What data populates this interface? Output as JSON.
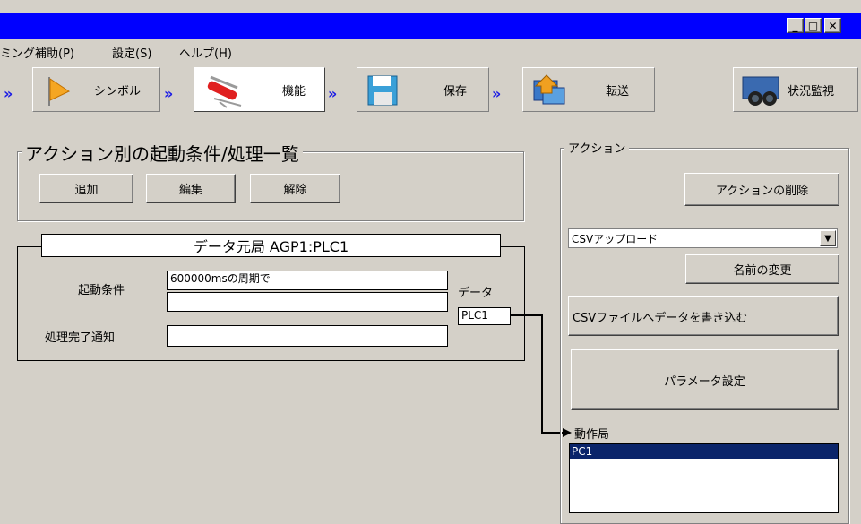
{
  "menu": {
    "items": [
      "ミング補助(P)",
      "設定(S)",
      "ヘルプ(H)"
    ]
  },
  "window_controls": {
    "minimize": "_",
    "maximize": "□",
    "close": "✕"
  },
  "toolbar": {
    "symbol_label": "シンボル",
    "function_label": "機能",
    "save_label": "保存",
    "transfer_label": "転送",
    "monitor_label": "状況監視",
    "arrow": "»"
  },
  "action_list": {
    "title": "アクション別の起動条件/処理一覧",
    "add_label": "追加",
    "edit_label": "編集",
    "delete_label": "解除"
  },
  "data_source": {
    "title": "データ元局 AGP1:PLC1",
    "trigger_label": "起動条件",
    "trigger_value": "600000msの周期で",
    "trigger_value2": "",
    "notify_label": "処理完了通知",
    "notify_value": "",
    "data_label": "データ",
    "data_station": "PLC1"
  },
  "action_panel": {
    "title": "アクション",
    "delete_action_label": "アクションの削除",
    "action_type": "CSVアップロード",
    "rename_label": "名前の変更",
    "write_csv_label": "CSVファイルへデータを書き込む",
    "param_label": "パラメータ設定",
    "operating_station_label": "動作局",
    "stations": [
      "PC1"
    ]
  }
}
